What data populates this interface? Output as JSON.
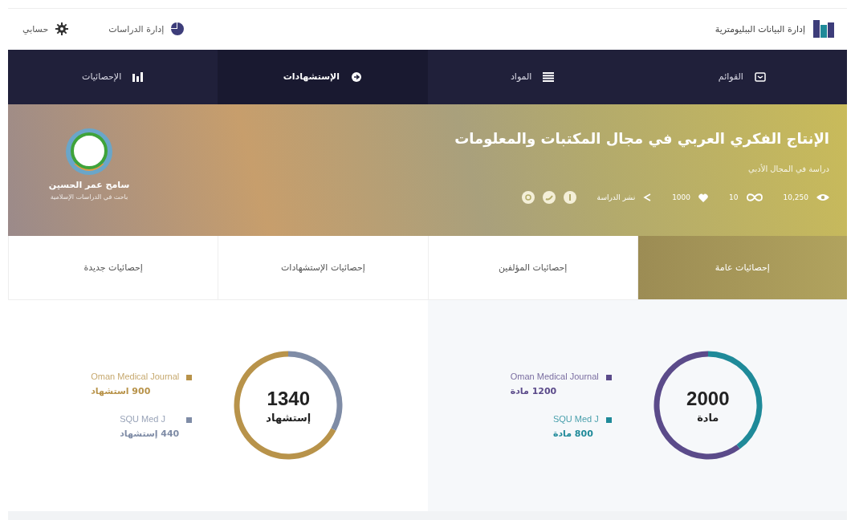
{
  "header": {
    "title": "إدارة البيانات الببليومترية",
    "links": [
      {
        "label": "إدارة الدراسات",
        "kind": "studies"
      },
      {
        "label": "حسابي",
        "kind": "account"
      }
    ]
  },
  "nav": {
    "tabs": [
      {
        "label": "القوائم",
        "kind": "lists",
        "selected": false
      },
      {
        "label": "المواد",
        "kind": "items",
        "selected": false
      },
      {
        "label": "الإستشهادات",
        "kind": "citations",
        "selected": true
      },
      {
        "label": "الإحصائيات",
        "kind": "stats",
        "selected": false
      }
    ]
  },
  "study": {
    "title": "الإنتاج الفكري العربي في مجال المكتبات والمعلومات",
    "subtitle": "دراسة في المجال الأدبي",
    "stats": [
      {
        "kind": "views",
        "value": "10,250"
      },
      {
        "kind": "links",
        "value": "10"
      },
      {
        "kind": "likes",
        "value": "1000"
      }
    ],
    "share_label": "نشر الدراسة",
    "author": {
      "name": "سامح عمر الحسين",
      "role": "باحث في الدراسات الإسلامية"
    }
  },
  "stat_tabs": [
    {
      "label": "إحصائيات عامة",
      "selected": true
    },
    {
      "label": "إحصائيات المؤلفين",
      "selected": false
    },
    {
      "label": "إحصائيات الإستشهادات",
      "selected": false
    },
    {
      "label": "إحصائيات جديدة",
      "selected": false
    }
  ],
  "panels": [
    {
      "total": "2000",
      "unit": "مادة",
      "legend": [
        {
          "value": "1200 مادة",
          "color": "#5b4b8a"
        },
        {
          "value": "800 مادة",
          "color": "#1f8a99"
        }
      ],
      "chart_data": {
        "type": "donut",
        "categories": [
          "Oman Medical Journal",
          "SQU Med J"
        ],
        "values": [
          60,
          40
        ]
      }
    },
    {
      "total": "1340",
      "unit": "إستشهاد",
      "legend": [
        {
          "value": "900 استشهاد",
          "color": "#b8934a"
        },
        {
          "value": "440 إستشهاد",
          "color": "#7f8ca6"
        }
      ],
      "chart_data": {
        "type": "donut",
        "categories": [
          "Oman Medical Journal",
          "SQU Med J"
        ],
        "values": [
          67.2,
          32.8
        ]
      }
    }
  ]
}
